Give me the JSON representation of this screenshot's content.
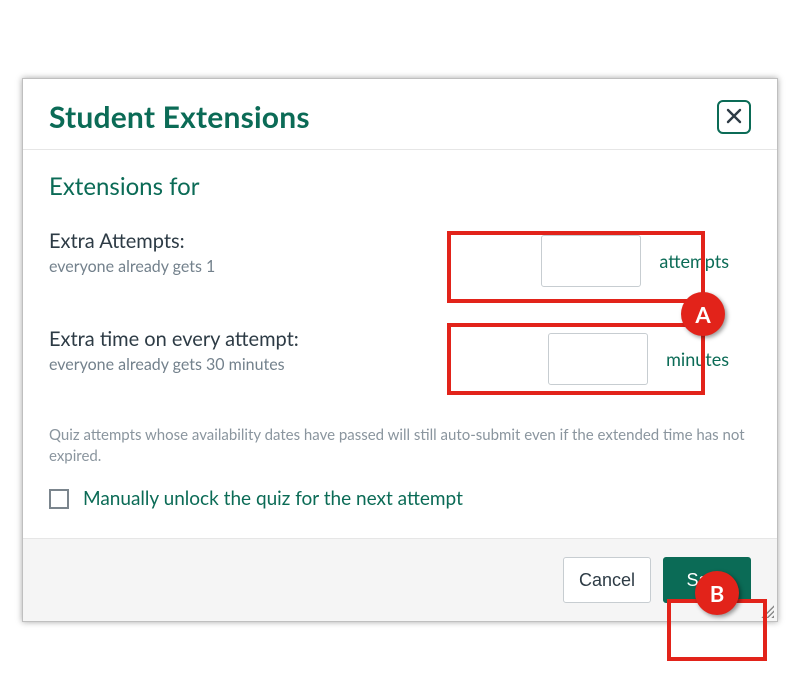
{
  "dialog": {
    "title": "Student Extensions",
    "subtitle": "Extensions for",
    "close_icon": "close-icon"
  },
  "fields": {
    "extra_attempts": {
      "label": "Extra Attempts:",
      "hint": "everyone already gets 1",
      "value": "",
      "unit": "attempts"
    },
    "extra_time": {
      "label": "Extra time on every attempt:",
      "hint": "everyone already gets 30 minutes",
      "value": "",
      "unit": "minutes"
    }
  },
  "auto_submit_note": "Quiz attempts whose availability dates have passed will still auto-submit even if the extended time has not expired.",
  "manual_unlock": {
    "checked": false,
    "label": "Manually unlock the quiz for the next attempt"
  },
  "footer": {
    "cancel": "Cancel",
    "save": "Save"
  },
  "annotations": {
    "a": "A",
    "b": "B",
    "color": "#e2231a"
  }
}
